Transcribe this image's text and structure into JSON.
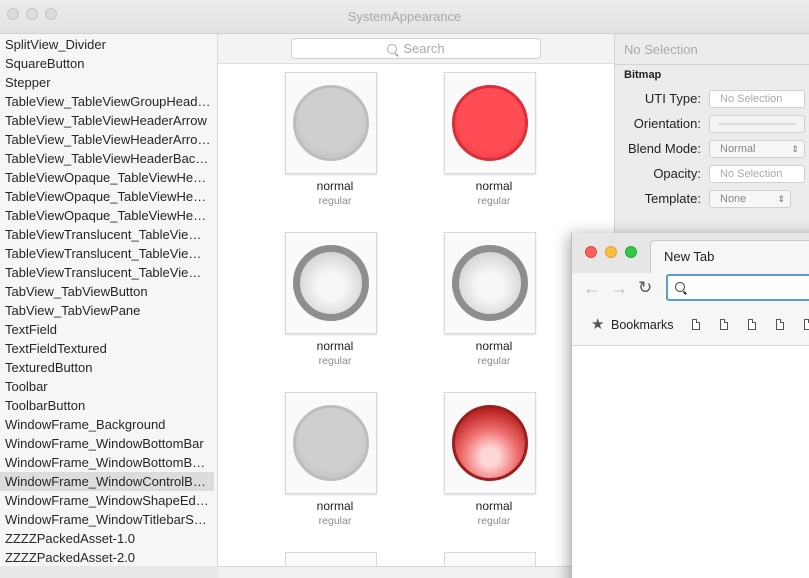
{
  "window": {
    "title": "SystemAppearance"
  },
  "sidebar": {
    "items": [
      "SplitView_Divider",
      "SquareButton",
      "Stepper",
      "TableView_TableViewGroupHead…",
      "TableView_TableViewHeaderArrow",
      "TableView_TableViewHeaderArro…",
      "TableView_TableViewHeaderBac…",
      "TableViewOpaque_TableViewHe…",
      "TableViewOpaque_TableViewHe…",
      "TableViewOpaque_TableViewHe…",
      "TableViewTranslucent_TableVie…",
      "TableViewTranslucent_TableVie…",
      "TableViewTranslucent_TableVie…",
      "TabView_TabViewButton",
      "TabView_TabViewPane",
      "TextField",
      "TextFieldTextured",
      "TexturedButton",
      "Toolbar",
      "ToolbarButton",
      "WindowFrame_Background",
      "WindowFrame_WindowBottomBar",
      "WindowFrame_WindowBottomB…",
      "WindowFrame_WindowControlB…",
      "WindowFrame_WindowShapeEd…",
      "WindowFrame_WindowTitlebarS…",
      "ZZZZPackedAsset-1.0",
      "ZZZZPackedAsset-2.0"
    ],
    "selected_index": 23
  },
  "search": {
    "placeholder": "Search"
  },
  "grid": {
    "cells": [
      {
        "name": "normal",
        "sub": "regular",
        "icon": "gray-circle"
      },
      {
        "name": "normal",
        "sub": "regular",
        "icon": "red-circle"
      },
      {
        "name": "normal",
        "sub": "regular",
        "icon": "gray-ring"
      },
      {
        "name": "normal",
        "sub": "regular",
        "icon": "gray-ring"
      },
      {
        "name": "normal",
        "sub": "regular",
        "icon": "gray-circle"
      },
      {
        "name": "normal",
        "sub": "regular",
        "icon": "red-glass-circle"
      }
    ]
  },
  "inspector": {
    "header": "No Selection",
    "section": "Bitmap",
    "uti_label": "UTI Type:",
    "uti_value": "No Selection",
    "orientation_label": "Orientation:",
    "blend_label": "Blend Mode:",
    "blend_value": "Normal",
    "opacity_label": "Opacity:",
    "opacity_value": "No Selection",
    "template_label": "Template:",
    "template_value": "None"
  },
  "browser": {
    "tab_title": "New Tab",
    "bookmarks_label": "Bookmarks",
    "omnibox_value": ""
  },
  "colors": {
    "close": "#fc605b",
    "minimize": "#fdbc40",
    "zoom": "#34c84a"
  }
}
